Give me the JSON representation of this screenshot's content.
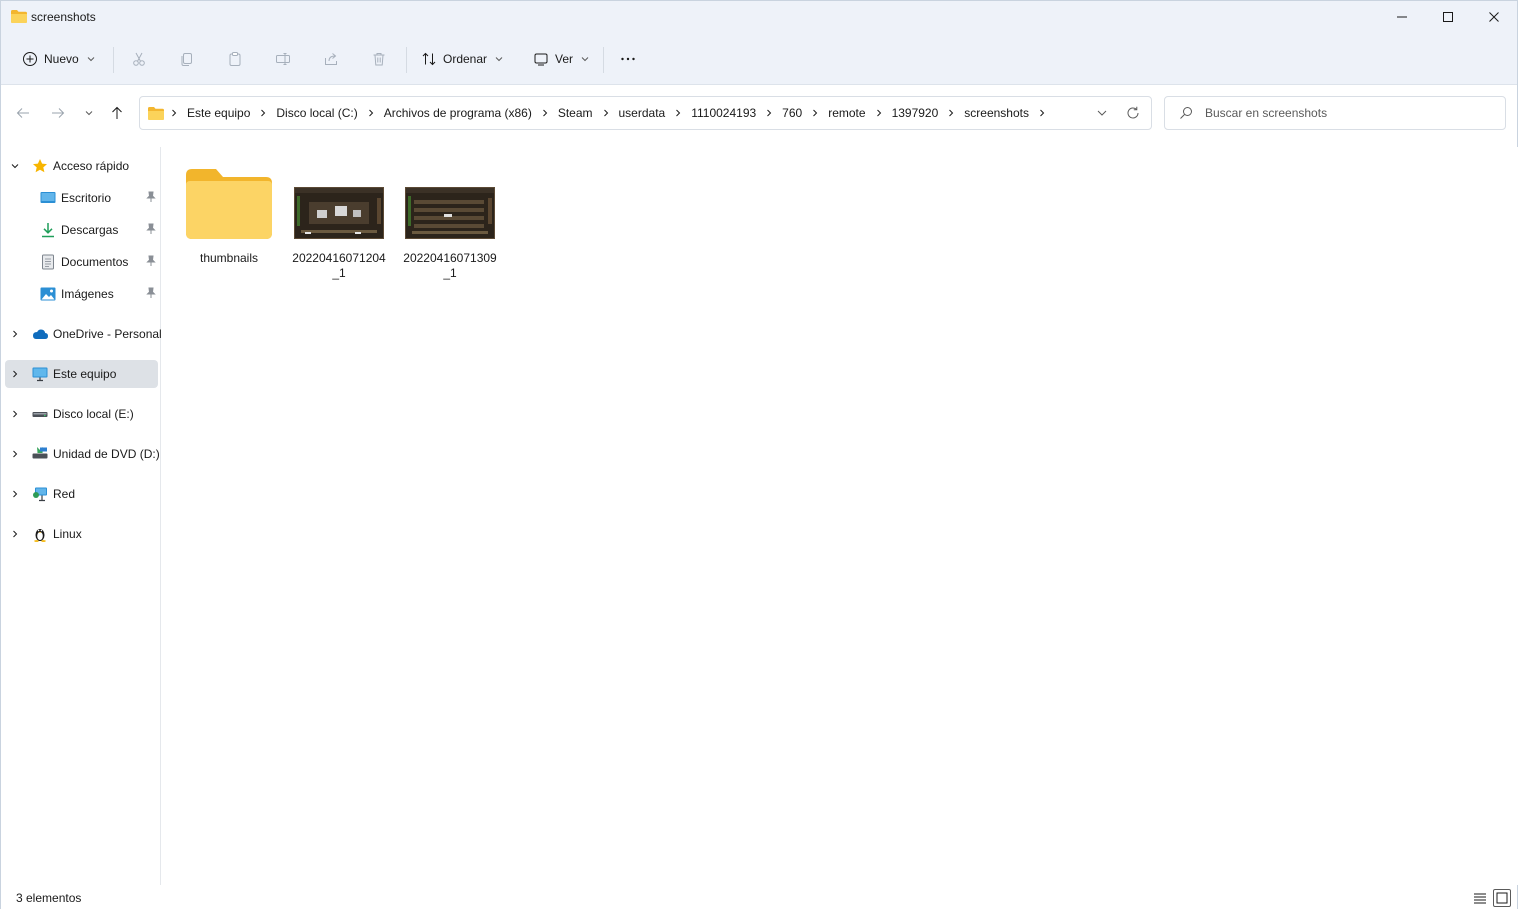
{
  "window": {
    "title": "screenshots"
  },
  "toolbar": {
    "new_label": "Nuevo",
    "sort_label": "Ordenar",
    "view_label": "Ver"
  },
  "address": {
    "crumbs": [
      "Este equipo",
      "Disco local (C:)",
      "Archivos de programa (x86)",
      "Steam",
      "userdata",
      "1110024193",
      "760",
      "remote",
      "1397920",
      "screenshots"
    ]
  },
  "search": {
    "placeholder": "Buscar en screenshots"
  },
  "sidebar": {
    "items": [
      {
        "label": "Acceso rápido"
      },
      {
        "label": "Escritorio"
      },
      {
        "label": "Descargas"
      },
      {
        "label": "Documentos"
      },
      {
        "label": "Imágenes"
      },
      {
        "label": "OneDrive - Personal"
      },
      {
        "label": "Este equipo"
      },
      {
        "label": "Disco local (E:)"
      },
      {
        "label": "Unidad de DVD (D:)"
      },
      {
        "label": "Red"
      },
      {
        "label": "Linux"
      }
    ]
  },
  "files": [
    {
      "name": "thumbnails",
      "kind": "folder"
    },
    {
      "name": "20220416071204_1",
      "kind": "image"
    },
    {
      "name": "20220416071309_1",
      "kind": "image"
    }
  ],
  "status": {
    "count": "3 elementos"
  },
  "colors": {
    "chrome": "#eef2f9",
    "selected": "#dde1e6",
    "folder": "#f8c93c",
    "accent": "#0067c0"
  }
}
